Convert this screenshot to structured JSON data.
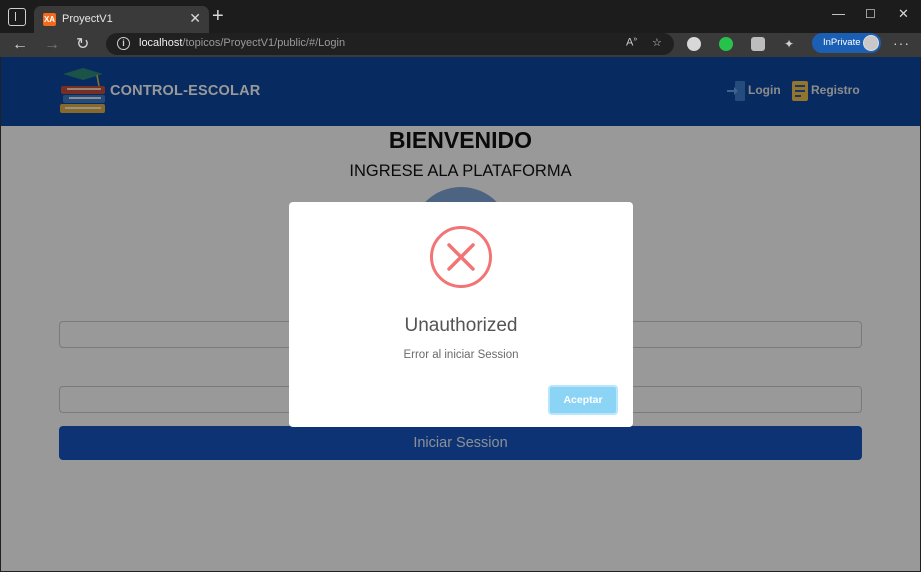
{
  "browser": {
    "tab_title": "ProyectV1",
    "favicon_text": "XA",
    "url_host": "localhost",
    "url_path": "/topicos/ProyectV1/public/#/Login",
    "inprivate_label": "InPrivate"
  },
  "navbar": {
    "brand": "CONTROL-ESCOLAR",
    "login_label": "Login",
    "register_label": "Registro",
    "color": "#0d47a1"
  },
  "page": {
    "title": "BIENVENIDO",
    "subtitle": "INGRESE ALA PLATAFORMA",
    "submit_label": "Iniciar Session"
  },
  "dialog": {
    "title": "Unauthorized",
    "message": "Error al iniciar Session",
    "confirm_label": "Aceptar",
    "icon": "error-x-icon",
    "icon_color": "#f27474"
  }
}
